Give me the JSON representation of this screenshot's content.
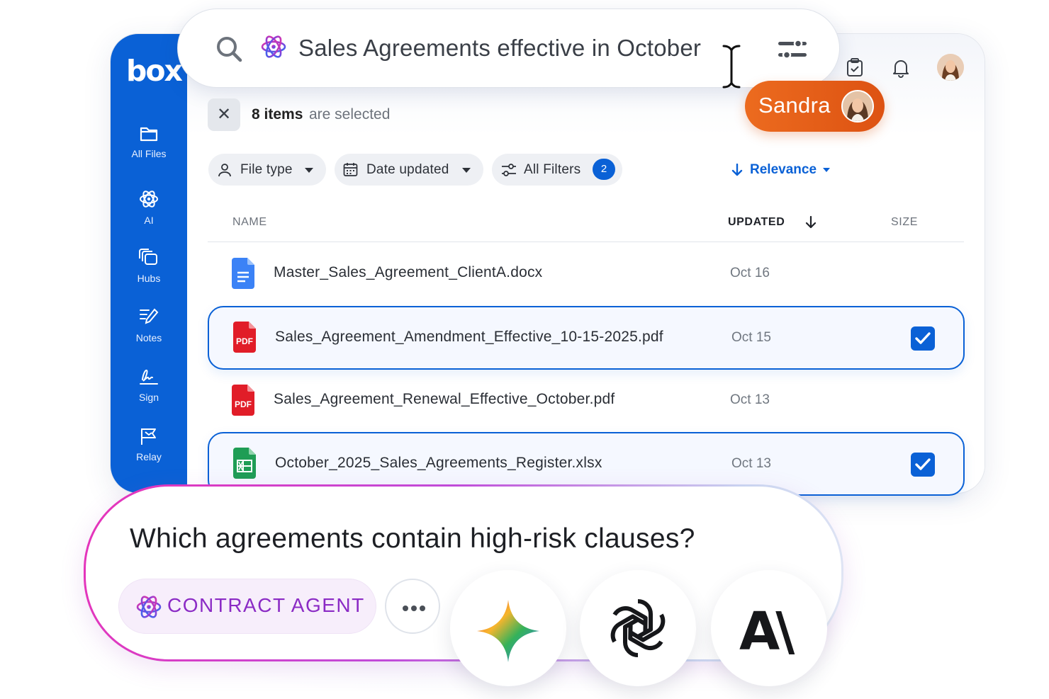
{
  "brand": {
    "logo_text": "box",
    "accent": "#0a61d6",
    "sandra_color": "#e25c17",
    "agent_color": "#8b2bc5"
  },
  "sidebar": {
    "items": [
      {
        "label": "All Files",
        "icon": "folder-icon"
      },
      {
        "label": "AI",
        "icon": "ai-atom-icon"
      },
      {
        "label": "Hubs",
        "icon": "hubs-icon"
      },
      {
        "label": "Notes",
        "icon": "notes-icon"
      },
      {
        "label": "Sign",
        "icon": "signature-icon"
      },
      {
        "label": "Relay",
        "icon": "flag-icon"
      }
    ]
  },
  "search": {
    "query": "Sales Agreements effective in October"
  },
  "collaborator": {
    "name": "Sandra"
  },
  "selection": {
    "count_text": "8 items",
    "rest_text": "are selected"
  },
  "filters": {
    "file_type": "File type",
    "date_updated": "Date updated",
    "all_filters": "All Filters",
    "all_filters_count": "2",
    "sort": "Relevance"
  },
  "table": {
    "columns": {
      "name": "NAME",
      "updated": "UPDATED",
      "size": "SIZE"
    },
    "rows": [
      {
        "name": "Master_Sales_Agreement_ClientA.docx",
        "updated": "Oct 16",
        "type": "docx",
        "selected": false
      },
      {
        "name": "Sales_Agreement_Amendment_Effective_10-15-2025.pdf",
        "updated": "Oct 15",
        "type": "pdf",
        "selected": true
      },
      {
        "name": "Sales_Agreement_Renewal_Effective_October.pdf",
        "updated": "Oct 13",
        "type": "pdf",
        "selected": false
      },
      {
        "name": "October_2025_Sales_Agreements_Register.xlsx",
        "updated": "Oct 13",
        "type": "xlsx",
        "selected": true
      }
    ]
  },
  "file_icon_labels": {
    "pdf": "PDF"
  },
  "prompt": {
    "question": "Which agreements contain high-risk clauses?",
    "agent_label": "CONTRACT AGENT"
  },
  "models": [
    {
      "name": "gemini-icon"
    },
    {
      "name": "openai-icon"
    },
    {
      "name": "anthropic-icon",
      "glyph": "A\\"
    }
  ]
}
